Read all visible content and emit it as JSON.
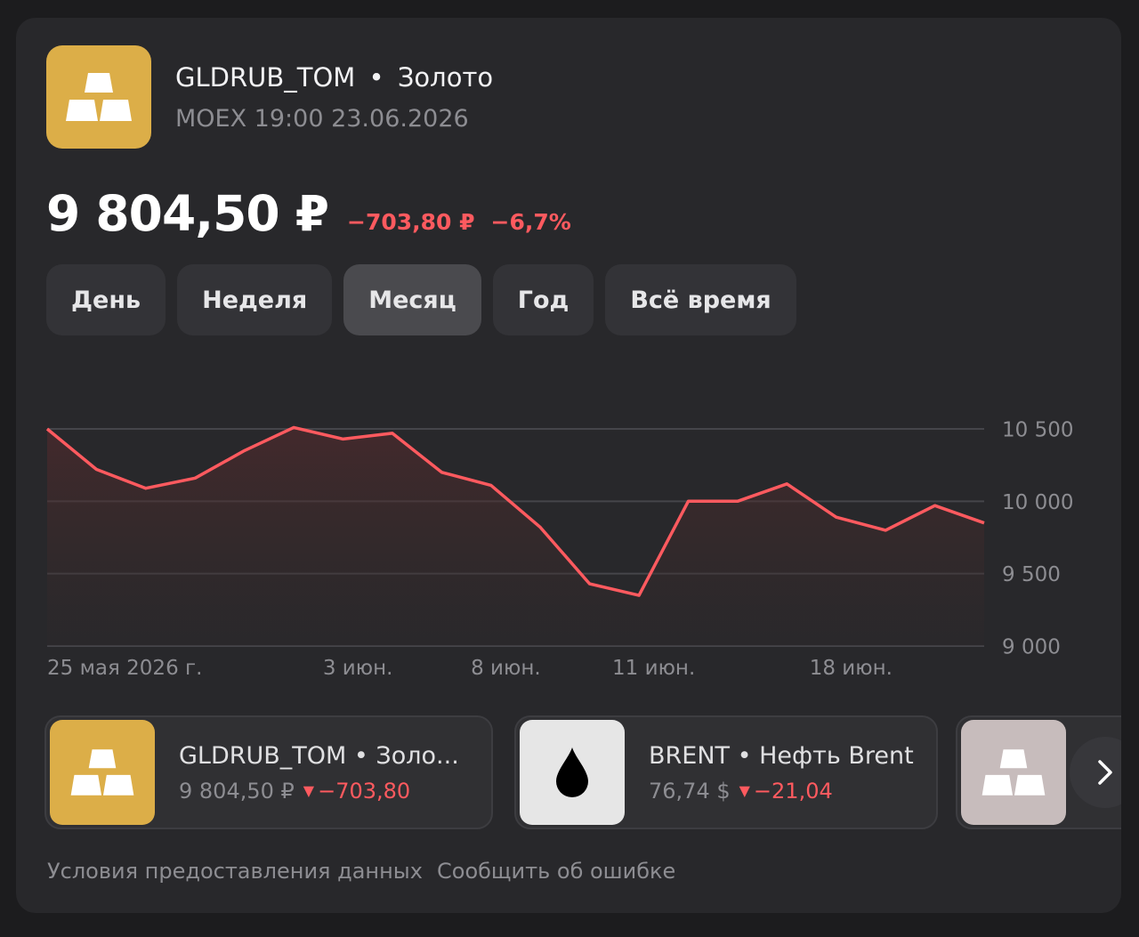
{
  "header": {
    "ticker": "GLDRUB_TOM",
    "separator": "•",
    "name": "Золото",
    "exchange_time": "MOEX 19:00 23.06.2026",
    "icon": "gold-bars-icon",
    "icon_color": "#dcae48"
  },
  "quote": {
    "price": "9 804,50 ₽",
    "change_abs": "−703,80 ₽",
    "change_pct": "−6,7%",
    "negative_color": "#ff5a5f"
  },
  "tabs": [
    {
      "label": "День",
      "active": false
    },
    {
      "label": "Неделя",
      "active": false
    },
    {
      "label": "Месяц",
      "active": true
    },
    {
      "label": "Год",
      "active": false
    },
    {
      "label": "Всё время",
      "active": false
    }
  ],
  "chart_data": {
    "type": "line",
    "series": [
      {
        "values": [
          10500,
          10220,
          10090,
          10160,
          10350,
          10510,
          10430,
          10470,
          10200,
          10110,
          9820,
          9430,
          9350,
          10000,
          10000,
          10120,
          9890,
          9800,
          9970,
          9850
        ]
      }
    ],
    "x_tick_labels": [
      "25 мая 2026 г.",
      "3 июн.",
      "8 июн.",
      "11 июн.",
      "18 июн."
    ],
    "y_tick_labels": [
      "10 500",
      "10 000",
      "9 500",
      "9 000"
    ],
    "y_ticks": [
      10500,
      10000,
      9500,
      9000
    ],
    "ylim": [
      9000,
      10500
    ],
    "grid": true,
    "line_color": "#ff5a5f"
  },
  "instruments": [
    {
      "name": "GLDRUB_TOM • Золо...",
      "price": "9 804,50 ₽",
      "change": "−703,80",
      "icon": "gold-bars-icon",
      "icon_bg": "#dcae48"
    },
    {
      "name": "BRENT • Нефть Brent",
      "price": "76,74 $",
      "change": "−21,04",
      "icon": "oil-drop-icon",
      "icon_bg": "#e6e6e6"
    },
    {
      "name": "",
      "icon": "silver-bars-icon",
      "icon_bg": "#c7bcbc"
    }
  ],
  "footer": {
    "terms": "Условия предоставления данных",
    "report": "Сообщить об ошибке"
  }
}
